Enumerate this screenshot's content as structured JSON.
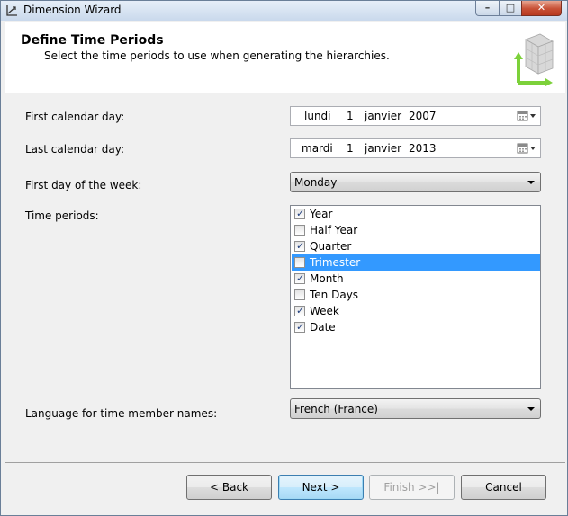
{
  "window": {
    "title": "Dimension Wizard",
    "icon": "wizard-app-icon",
    "controls": {
      "minimize": "–",
      "maximize": "□",
      "close": "✕"
    }
  },
  "header": {
    "title": "Define Time Periods",
    "subtitle": "Select the time periods to use when generating the hierarchies.",
    "graphic": "cube-axes-icon"
  },
  "form": {
    "first_day": {
      "label": "First calendar day:",
      "weekday": "lundi",
      "day": "1",
      "month": "janvier",
      "year": "2007"
    },
    "last_day": {
      "label": "Last calendar day:",
      "weekday": "mardi",
      "day": "1",
      "month": "janvier",
      "year": "2013"
    },
    "week_start": {
      "label": "First day of the week:",
      "value": "Monday"
    },
    "time_periods": {
      "label": "Time periods:",
      "items": [
        {
          "label": "Year",
          "checked": true,
          "selected": false
        },
        {
          "label": "Half Year",
          "checked": false,
          "selected": false
        },
        {
          "label": "Quarter",
          "checked": true,
          "selected": false
        },
        {
          "label": "Trimester",
          "checked": false,
          "selected": true
        },
        {
          "label": "Month",
          "checked": true,
          "selected": false
        },
        {
          "label": "Ten Days",
          "checked": false,
          "selected": false
        },
        {
          "label": "Week",
          "checked": true,
          "selected": false
        },
        {
          "label": "Date",
          "checked": true,
          "selected": false
        }
      ]
    },
    "language": {
      "label": "Language for time member names:",
      "value": "French (France)"
    }
  },
  "buttons": {
    "back": "< Back",
    "next": "Next >",
    "finish": "Finish >>|",
    "cancel": "Cancel"
  },
  "colors": {
    "selection": "#3399ff",
    "check": "#213f7e",
    "graphic_accent": "#7cd13a"
  }
}
